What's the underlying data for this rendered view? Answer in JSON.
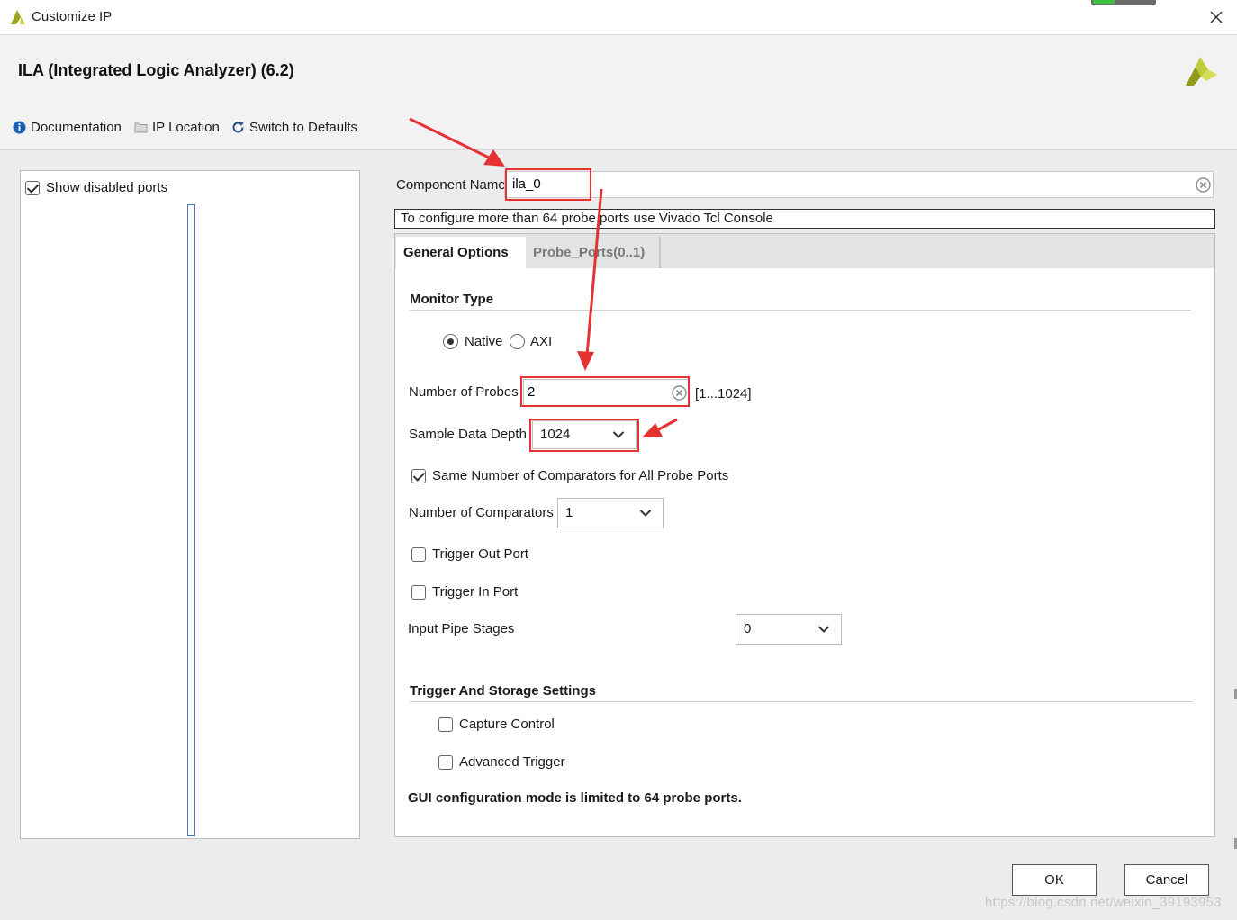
{
  "window": {
    "title": "Customize IP"
  },
  "header": {
    "ip_title": "ILA (Integrated Logic Analyzer) (6.2)",
    "links": {
      "documentation": "Documentation",
      "ip_location": "IP Location",
      "switch_defaults": "Switch to Defaults"
    }
  },
  "left_panel": {
    "show_disabled_label": "Show disabled ports",
    "show_disabled_checked": true
  },
  "component": {
    "label": "Component Name",
    "value": "ila_0"
  },
  "info": "To configure more than 64 probe ports use Vivado Tcl Console",
  "tabs": [
    {
      "label": "General Options",
      "active": true
    },
    {
      "label": "Probe_Ports(0..1)",
      "active": false
    }
  ],
  "general": {
    "monitor_type": {
      "title": "Monitor Type",
      "options": [
        "Native",
        "AXI"
      ],
      "selected": "Native"
    },
    "num_probes": {
      "label": "Number of Probes",
      "value": "2",
      "range": "[1...1024]"
    },
    "sample_depth": {
      "label": "Sample Data Depth",
      "value": "1024"
    },
    "same_comparators": {
      "label": "Same Number of Comparators for All Probe Ports",
      "checked": true
    },
    "num_comparators": {
      "label": "Number of Comparators",
      "value": "1"
    },
    "trigger_out": {
      "label": "Trigger Out Port",
      "checked": false
    },
    "trigger_in": {
      "label": "Trigger In Port",
      "checked": false
    },
    "input_pipe": {
      "label": "Input Pipe Stages",
      "value": "0"
    },
    "trigger_storage": {
      "title": "Trigger And Storage Settings",
      "capture_control": {
        "label": "Capture Control",
        "checked": false
      },
      "advanced_trigger": {
        "label": "Advanced Trigger",
        "checked": false
      }
    },
    "gui_note": "GUI configuration mode is limited to 64 probe ports."
  },
  "buttons": {
    "ok": "OK",
    "cancel": "Cancel"
  },
  "watermark": "https://blog.csdn.net/weixin_39193953",
  "colors": {
    "annotation_red": "#e53333",
    "xilinx_olive": "#a4b12a",
    "info_blue": "#1f5fb5"
  }
}
